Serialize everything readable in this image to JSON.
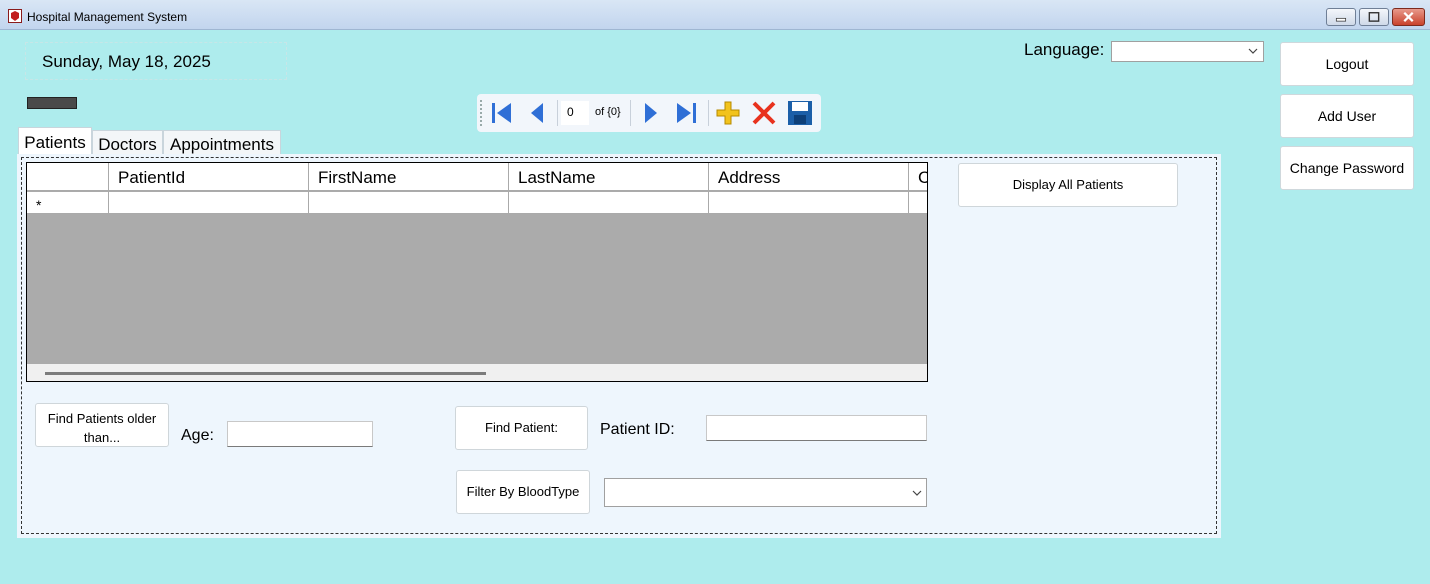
{
  "window": {
    "title": "Hospital Management System"
  },
  "header": {
    "date_text": "Sunday, May 18, 2025",
    "language_label": "Language:",
    "language_value": ""
  },
  "side_buttons": {
    "logout": "Logout",
    "add_user": "Add User",
    "change_password": "Change Password"
  },
  "navigator": {
    "position": "0",
    "count_text": "of {0}"
  },
  "tabs": [
    {
      "label": "Patients",
      "active": true
    },
    {
      "label": "Doctors",
      "active": false
    },
    {
      "label": "Appointments",
      "active": false
    }
  ],
  "grid": {
    "columns": [
      "PatientId",
      "FirstName",
      "LastName",
      "Address",
      "C"
    ],
    "new_row_marker": "*"
  },
  "patients_tab": {
    "display_all_label": "Display All Patients",
    "find_older_label": "Find Patients older than...",
    "age_label": "Age:",
    "age_value": "",
    "find_patient_label": "Find Patient:",
    "patient_id_label": "Patient ID:",
    "patient_id_value": "",
    "filter_blood_label": "Filter By BloodType",
    "blood_type_value": ""
  },
  "colors": {
    "background": "#aeeced",
    "panel": "#eef6fd",
    "grid_empty": "#ababab",
    "nav_arrow": "#2f6fd6",
    "add_icon": "#f2c31d",
    "delete_icon": "#e8321e",
    "save_icon": "#1c5fa8"
  },
  "icons": {
    "app": "hospital-app-icon",
    "nav": [
      "move-first-icon",
      "move-previous-icon",
      "move-next-icon",
      "move-last-icon"
    ],
    "actions": [
      "add-new-icon",
      "delete-icon",
      "save-icon"
    ]
  }
}
